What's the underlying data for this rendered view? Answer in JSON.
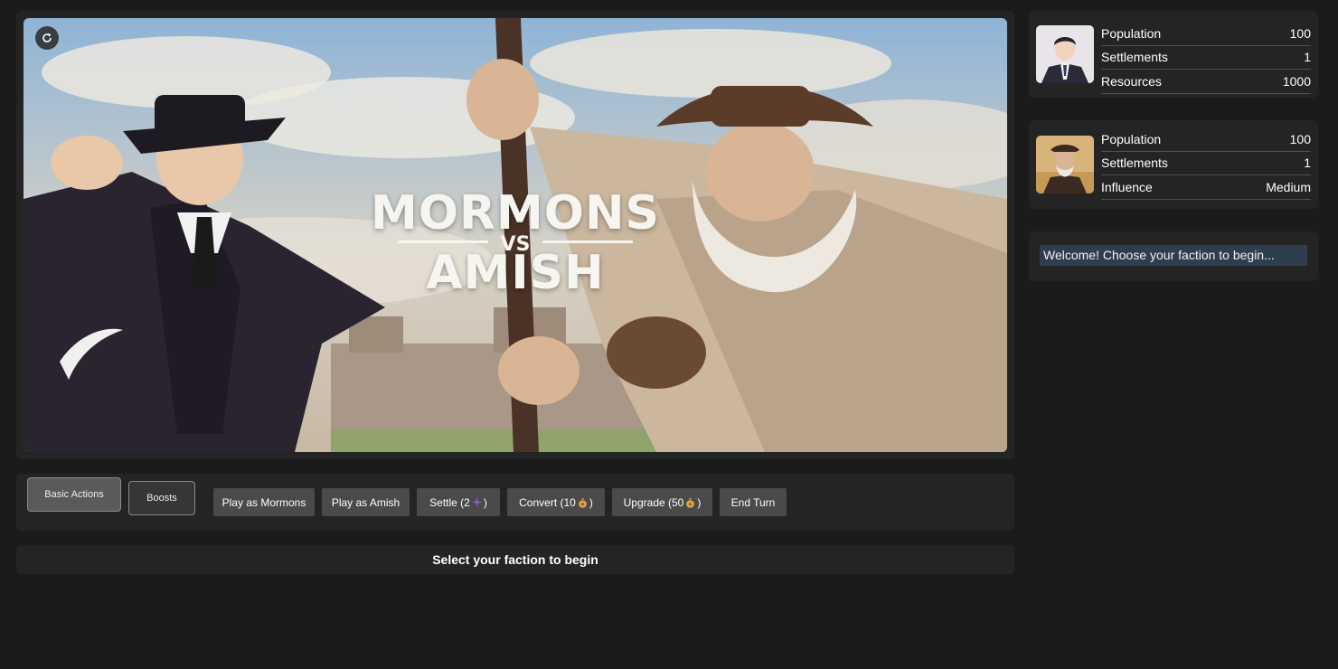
{
  "hero": {
    "title_top": "MORMONS",
    "title_vs": "VS",
    "title_bottom": "AMISH"
  },
  "icons": {
    "refresh": "refresh-icon",
    "settle": "purple-sparkle-icon",
    "convert": "money-bag-icon",
    "upgrade": "money-bag-icon"
  },
  "mormons": {
    "rows": [
      {
        "label": "Population",
        "value": "100"
      },
      {
        "label": "Settlements",
        "value": "1"
      },
      {
        "label": "Resources",
        "value": "1000"
      }
    ]
  },
  "amish": {
    "rows": [
      {
        "label": "Population",
        "value": "100"
      },
      {
        "label": "Settlements",
        "value": "1"
      },
      {
        "label": "Influence",
        "value": "Medium"
      }
    ]
  },
  "log": {
    "message": "Welcome! Choose your faction to begin..."
  },
  "tabs": {
    "basic": "Basic Actions",
    "boosts": "Boosts"
  },
  "actions": {
    "play_mormons": "Play as Mormons",
    "play_amish": "Play as Amish",
    "settle_prefix": "Settle (2",
    "convert_prefix": "Convert (10",
    "upgrade_prefix": "Upgrade (50",
    "close_paren": ")",
    "end_turn": "End Turn"
  },
  "status": {
    "message": "Select your faction to begin"
  },
  "colors": {
    "background": "#1b1b1b",
    "panel": "#242424",
    "button": "#4a4a4a",
    "log_highlight": "#2f3e4f"
  }
}
